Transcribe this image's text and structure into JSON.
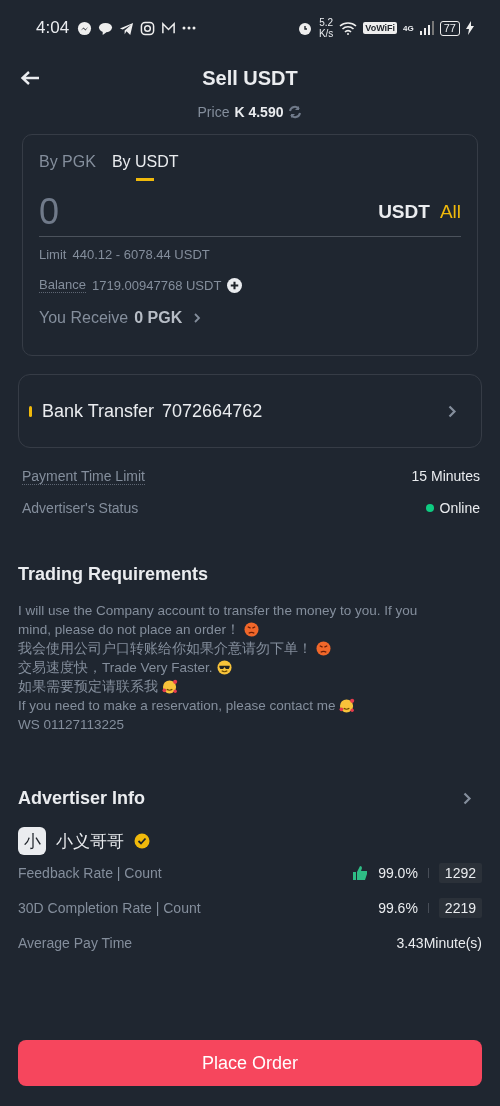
{
  "status_bar": {
    "time": "4:04",
    "speed": "5.2",
    "speed_unit": "K/s",
    "vowifi": "VoWiFi",
    "network": "4G",
    "battery": "77"
  },
  "header": {
    "title": "Sell USDT",
    "price_label": "Price",
    "price": "K 4.590"
  },
  "tabs": [
    {
      "label": "By PGK",
      "selected": false
    },
    {
      "label": "By USDT",
      "selected": true
    }
  ],
  "amount": {
    "placeholder": "0",
    "currency": "USDT",
    "all": "All"
  },
  "limit": {
    "label": "Limit",
    "value": "440.12 - 6078.44 USDT"
  },
  "balance": {
    "label": "Balance",
    "value": "1719.00947768 USDT"
  },
  "receive": {
    "label": "You Receive",
    "value": "0 PGK"
  },
  "payment": {
    "method": "Bank Transfer",
    "account": "7072664762"
  },
  "info_rows": [
    {
      "label": "Payment Time Limit",
      "value": "15 Minutes",
      "kind": "plain"
    },
    {
      "label": "Advertiser's Status",
      "value": "Online",
      "kind": "status",
      "color": "#0ecb81"
    }
  ],
  "requirements": {
    "title": "Trading Requirements",
    "lines": [
      {
        "text": "I will use the Company account to transfer the money to you. If you"
      },
      {
        "text": "mind, please do not place an order！",
        "kind": "angry"
      },
      {
        "text": "我会使用公司户口转账给你如果介意请勿下单！",
        "kind": "angry"
      },
      {
        "text": "交易速度快，Trade Very Faster.",
        "kind": "cool"
      },
      {
        "text": "如果需要预定请联系我",
        "kind": "love"
      },
      {
        "text": "If you need to make a reservation, please contact me",
        "kind": "love"
      },
      {
        "text": "WS 01127113225"
      }
    ]
  },
  "advertiser": {
    "title": "Advertiser Info",
    "avatar": "小",
    "name": "小义哥哥",
    "verified": true,
    "stats": [
      {
        "label": "Feedback Rate | Count",
        "rate": "99.0%",
        "count": "1292",
        "kind": "feedback"
      },
      {
        "label": "30D Completion Rate | Count",
        "rate": "99.6%",
        "count": "2219",
        "kind": "rate"
      },
      {
        "label": "Average Pay Time",
        "value": "3.43Minute(s)",
        "kind": "plain"
      }
    ]
  },
  "button": "Place Order"
}
